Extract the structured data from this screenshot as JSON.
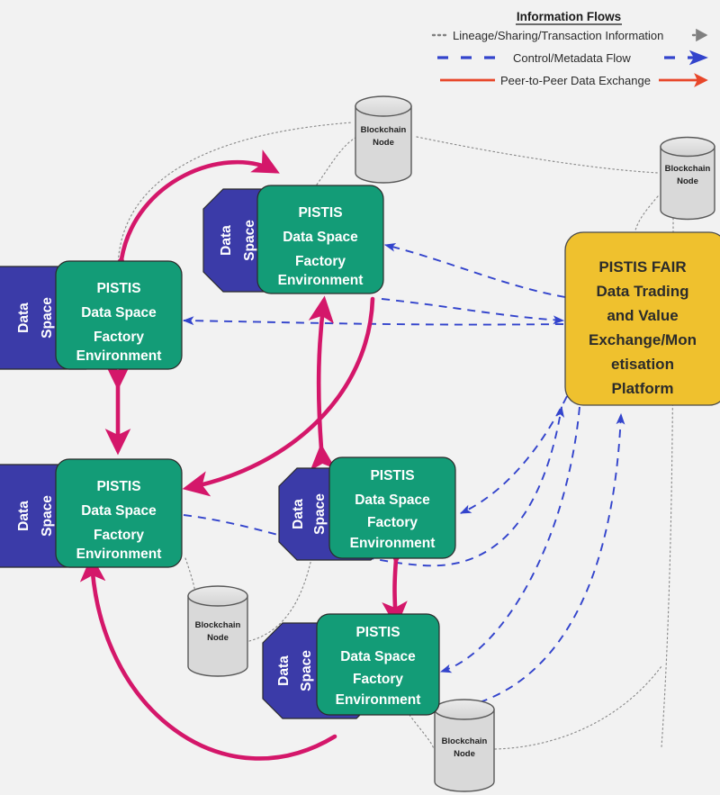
{
  "diagram": {
    "background_color": "#f2f2f2",
    "legend": {
      "title": "Information Flows",
      "items": [
        {
          "label": "Lineage/Sharing/Transaction Information",
          "style": "dotted",
          "color": "#808080"
        },
        {
          "label": "Control/Metadata Flow",
          "style": "dashed",
          "color": "#3344cc"
        },
        {
          "label": "Peer-to-Peer Data Exchange",
          "style": "solid",
          "color": "#e8472a"
        }
      ]
    },
    "palette": {
      "data_space_blue": "#3b3ba8",
      "factory_green": "#139c77",
      "fair_yellow": "#efc12e",
      "blockchain_gray": "#d9d9d9",
      "blockchain_stroke": "#595959",
      "peer_arrow": "#d4176a",
      "control_arrow": "#3344cc",
      "lineage_line": "#8a8a8a"
    },
    "factory_nodes": [
      {
        "id": "dsfe-left-top",
        "data_space_label_line1": "Data",
        "data_space_label_line2": "Space",
        "title_lines": [
          "PISTIS",
          "Data Space",
          "Factory",
          "Environment"
        ]
      },
      {
        "id": "dsfe-center-top",
        "data_space_label_line1": "Data",
        "data_space_label_line2": "Space",
        "title_lines": [
          "PISTIS",
          "Data Space",
          "Factory",
          "Environment"
        ]
      },
      {
        "id": "dsfe-left-mid",
        "data_space_label_line1": "Data",
        "data_space_label_line2": "Space",
        "title_lines": [
          "PISTIS",
          "Data Space",
          "Factory",
          "Environment"
        ]
      },
      {
        "id": "dsfe-center-mid",
        "data_space_label_line1": "Data",
        "data_space_label_line2": "Space",
        "title_lines": [
          "PISTIS",
          "Data Space",
          "Factory",
          "Environment"
        ]
      },
      {
        "id": "dsfe-center-bot",
        "data_space_label_line1": "Data",
        "data_space_label_line2": "Space",
        "title_lines": [
          "PISTIS",
          "Data Space",
          "Factory",
          "Environment"
        ]
      }
    ],
    "fair_platform": {
      "id": "pistis-fair-platform",
      "lines": [
        "PISTIS FAIR",
        "Data Trading",
        "and Value",
        "Exchange/Mon",
        "etisation",
        "Platform"
      ]
    },
    "blockchain_nodes": [
      {
        "id": "blockchain-node-top-center",
        "line1": "Blockchain",
        "line2": "Node"
      },
      {
        "id": "blockchain-node-top-right",
        "line1": "Blockchain",
        "line2": "Node"
      },
      {
        "id": "blockchain-node-bottom-left",
        "line1": "Blockchain",
        "line2": "Node"
      },
      {
        "id": "blockchain-node-bottom-right",
        "line1": "Blockchain",
        "line2": "Node"
      }
    ]
  }
}
